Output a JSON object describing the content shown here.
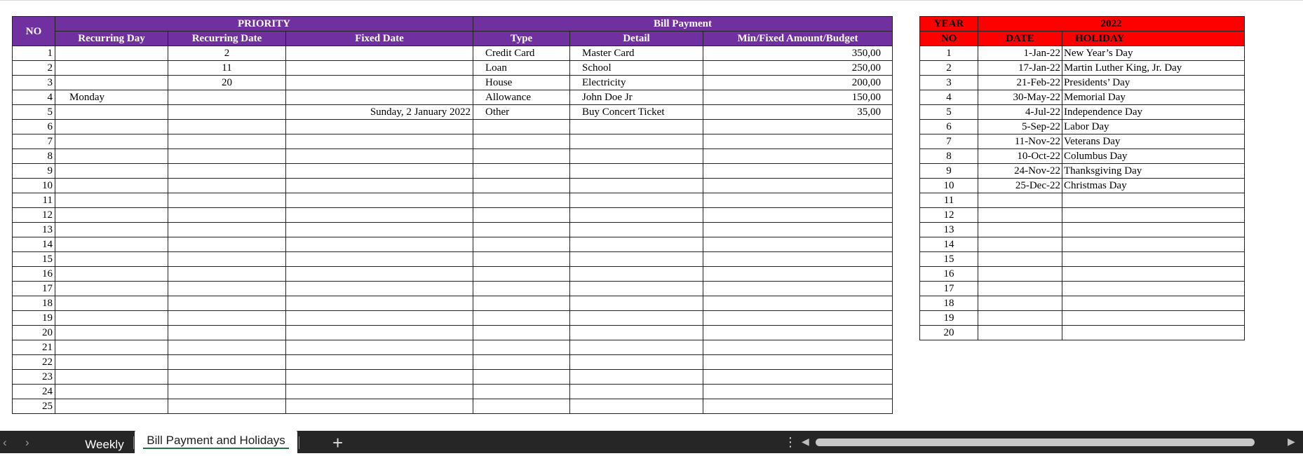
{
  "bill": {
    "headers": {
      "no": "NO",
      "priority": "PRIORITY",
      "bill_payment": "Bill Payment",
      "recurring_day": "Recurring Day",
      "recurring_date": "Recurring Date",
      "fixed_date": "Fixed Date",
      "type": "Type",
      "detail": "Detail",
      "amount": "Min/Fixed Amount/Budget"
    },
    "rows": [
      {
        "no": "1",
        "rday": "",
        "rdate": "2",
        "fixed": "",
        "type": "Credit Card",
        "detail": "Master Card",
        "amount": "350,00"
      },
      {
        "no": "2",
        "rday": "",
        "rdate": "11",
        "fixed": "",
        "type": "Loan",
        "detail": "School",
        "amount": "250,00"
      },
      {
        "no": "3",
        "rday": "",
        "rdate": "20",
        "fixed": "",
        "type": "House",
        "detail": "Electricity",
        "amount": "200,00"
      },
      {
        "no": "4",
        "rday": "Monday",
        "rdate": "",
        "fixed": "",
        "type": "Allowance",
        "detail": "John Doe Jr",
        "amount": "150,00"
      },
      {
        "no": "5",
        "rday": "",
        "rdate": "",
        "fixed": "Sunday, 2 January 2022",
        "type": "Other",
        "detail": "Buy Concert Ticket",
        "amount": "35,00"
      },
      {
        "no": "6",
        "rday": "",
        "rdate": "",
        "fixed": "",
        "type": "",
        "detail": "",
        "amount": ""
      },
      {
        "no": "7",
        "rday": "",
        "rdate": "",
        "fixed": "",
        "type": "",
        "detail": "",
        "amount": ""
      },
      {
        "no": "8",
        "rday": "",
        "rdate": "",
        "fixed": "",
        "type": "",
        "detail": "",
        "amount": ""
      },
      {
        "no": "9",
        "rday": "",
        "rdate": "",
        "fixed": "",
        "type": "",
        "detail": "",
        "amount": ""
      },
      {
        "no": "10",
        "rday": "",
        "rdate": "",
        "fixed": "",
        "type": "",
        "detail": "",
        "amount": ""
      },
      {
        "no": "11",
        "rday": "",
        "rdate": "",
        "fixed": "",
        "type": "",
        "detail": "",
        "amount": ""
      },
      {
        "no": "12",
        "rday": "",
        "rdate": "",
        "fixed": "",
        "type": "",
        "detail": "",
        "amount": ""
      },
      {
        "no": "13",
        "rday": "",
        "rdate": "",
        "fixed": "",
        "type": "",
        "detail": "",
        "amount": ""
      },
      {
        "no": "14",
        "rday": "",
        "rdate": "",
        "fixed": "",
        "type": "",
        "detail": "",
        "amount": ""
      },
      {
        "no": "15",
        "rday": "",
        "rdate": "",
        "fixed": "",
        "type": "",
        "detail": "",
        "amount": ""
      },
      {
        "no": "16",
        "rday": "",
        "rdate": "",
        "fixed": "",
        "type": "",
        "detail": "",
        "amount": ""
      },
      {
        "no": "17",
        "rday": "",
        "rdate": "",
        "fixed": "",
        "type": "",
        "detail": "",
        "amount": ""
      },
      {
        "no": "18",
        "rday": "",
        "rdate": "",
        "fixed": "",
        "type": "",
        "detail": "",
        "amount": ""
      },
      {
        "no": "19",
        "rday": "",
        "rdate": "",
        "fixed": "",
        "type": "",
        "detail": "",
        "amount": ""
      },
      {
        "no": "20",
        "rday": "",
        "rdate": "",
        "fixed": "",
        "type": "",
        "detail": "",
        "amount": ""
      },
      {
        "no": "21",
        "rday": "",
        "rdate": "",
        "fixed": "",
        "type": "",
        "detail": "",
        "amount": ""
      },
      {
        "no": "22",
        "rday": "",
        "rdate": "",
        "fixed": "",
        "type": "",
        "detail": "",
        "amount": ""
      },
      {
        "no": "23",
        "rday": "",
        "rdate": "",
        "fixed": "",
        "type": "",
        "detail": "",
        "amount": ""
      },
      {
        "no": "24",
        "rday": "",
        "rdate": "",
        "fixed": "",
        "type": "",
        "detail": "",
        "amount": ""
      },
      {
        "no": "25",
        "rday": "",
        "rdate": "",
        "fixed": "",
        "type": "",
        "detail": "",
        "amount": ""
      }
    ]
  },
  "holidays": {
    "headers": {
      "year": "YEAR",
      "year_value": "2022",
      "no": "NO",
      "date": "DATE",
      "holiday": "HOLIDAY"
    },
    "rows": [
      {
        "no": "1",
        "date": "1-Jan-22",
        "holiday": "New Year’s Day"
      },
      {
        "no": "2",
        "date": "17-Jan-22",
        "holiday": "Martin Luther King, Jr. Day"
      },
      {
        "no": "3",
        "date": "21-Feb-22",
        "holiday": "Presidents’ Day"
      },
      {
        "no": "4",
        "date": "30-May-22",
        "holiday": "Memorial Day"
      },
      {
        "no": "5",
        "date": "4-Jul-22",
        "holiday": "Independence Day"
      },
      {
        "no": "6",
        "date": "5-Sep-22",
        "holiday": "Labor Day"
      },
      {
        "no": "7",
        "date": "11-Nov-22",
        "holiday": "Veterans Day"
      },
      {
        "no": "8",
        "date": "10-Oct-22",
        "holiday": "Columbus Day"
      },
      {
        "no": "9",
        "date": "24-Nov-22",
        "holiday": "Thanksgiving Day"
      },
      {
        "no": "10",
        "date": "25-Dec-22",
        "holiday": "Christmas Day"
      },
      {
        "no": "11",
        "date": "",
        "holiday": ""
      },
      {
        "no": "12",
        "date": "",
        "holiday": ""
      },
      {
        "no": "13",
        "date": "",
        "holiday": ""
      },
      {
        "no": "14",
        "date": "",
        "holiday": ""
      },
      {
        "no": "15",
        "date": "",
        "holiday": ""
      },
      {
        "no": "16",
        "date": "",
        "holiday": ""
      },
      {
        "no": "17",
        "date": "",
        "holiday": ""
      },
      {
        "no": "18",
        "date": "",
        "holiday": ""
      },
      {
        "no": "19",
        "date": "",
        "holiday": ""
      },
      {
        "no": "20",
        "date": "",
        "holiday": ""
      }
    ]
  },
  "tabs": {
    "items": [
      {
        "label": "Weekly",
        "active": false
      },
      {
        "label": "Bill Payment and Holidays",
        "active": true
      }
    ],
    "prev_icon": "chevron-left-icon",
    "next_icon": "chevron-right-icon",
    "add_icon": "plus-icon",
    "more_icon": "vertical-ellipsis-icon"
  },
  "colors": {
    "priority_header": "#7030a0",
    "holiday_header": "#ff0000",
    "tabbar": "#262626"
  }
}
